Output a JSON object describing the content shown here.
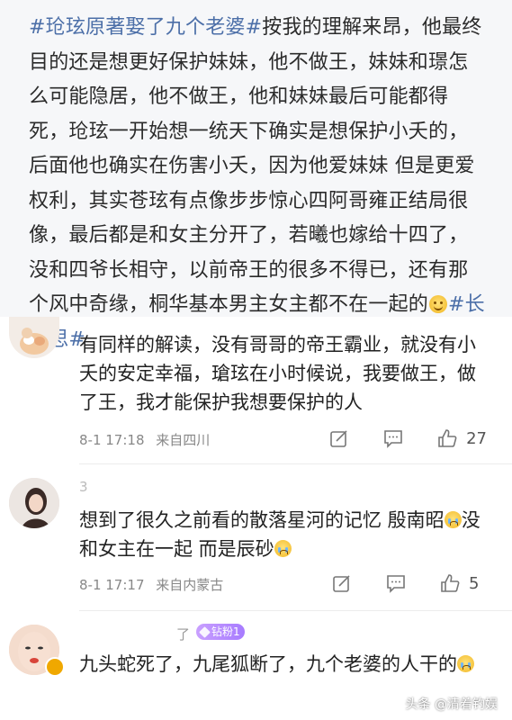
{
  "post": {
    "tag_start": "#玱玹原著娶了九个老婆#",
    "body": "按我的理解来昂，他最终目的还是想更好保护妹妹，他不做王，妹妹和璟怎么可能隐居，他不做王，他和妹妹最后可能都得死，玱玹一开始想一统天下确实是想保护小夭的，后面他也确实在伤害小夭，因为他爱妹妹 但是更爱权利，其实苍玹有点像步步惊心四阿哥雍正结局很像，最后都是和女主分开了，若曦也嫁给十四了，没和四爷长相守，以前帝王的很多不得已，还有那个风中奇缘，桐华基本男主女主都不在一起的",
    "emoji": "smile-emoji",
    "tag_end": "#长相思#"
  },
  "comments": [
    {
      "text": "有同样的解读，没有哥哥的帝王霸业，就没有小夭的安定幸福，瑲玹在小时候说，我要做王，做了王，我才能保护我想要保护的人",
      "time": "8-1 17:18",
      "location": "来自四川",
      "likes": "27"
    },
    {
      "username_fragment": "3",
      "text_a": "想到了很久之前看的散落星河的记忆 殷南昭",
      "text_b": "没和女主在一起 而是辰砂",
      "time": "8-1 17:17",
      "location": "来自内蒙古",
      "likes": "5"
    },
    {
      "username_fragment": "了",
      "badge": "钻粉1",
      "text": "九头蛇死了，九尾狐断了，九个老婆的人干的"
    }
  ],
  "watermark": {
    "text": "头条 @清着钓娱"
  },
  "colors": {
    "tag": "#4c6fa8",
    "post_bg": "#f6f7f9",
    "meta": "#888888"
  },
  "icons": {
    "repost": "repost-icon",
    "comment": "comment-icon",
    "like": "like-icon"
  }
}
